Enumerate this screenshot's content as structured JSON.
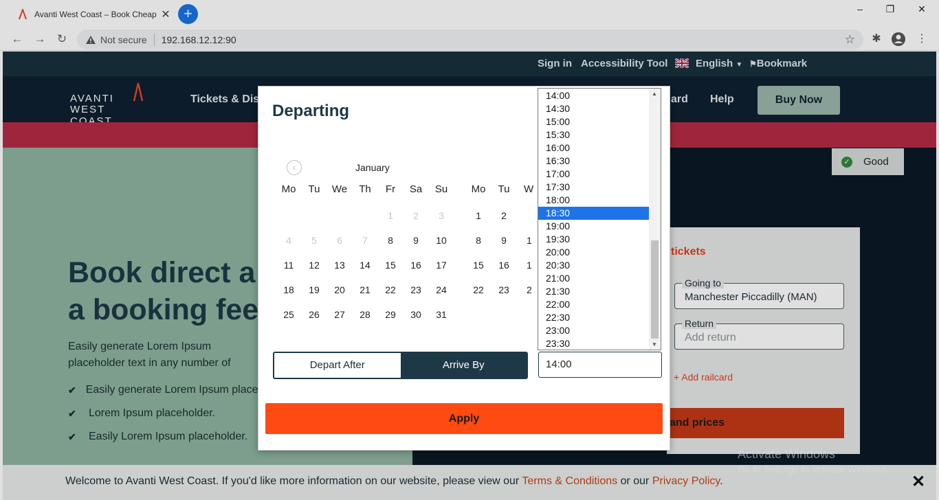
{
  "browser": {
    "tab_title": "Avanti West Coast – Book Cheap",
    "security_label": "Not secure",
    "url": "192.168.12.12:90",
    "new_tab_symbol": "+",
    "close_symbol": "✕"
  },
  "site": {
    "topbar": {
      "sign_in": "Sign in",
      "accessibility": "Accessibility Tool",
      "language": "English",
      "bookmark": "Bookmark"
    },
    "logo": {
      "line1": "AVANTI",
      "line2": "WEST COAST"
    },
    "nav": {
      "tickets": "Tickets & Disc",
      "board": "ard",
      "help": "Help",
      "buy_now": "Buy Now"
    },
    "good_badge": "Good",
    "hero": {
      "headline_1": "Book direct a",
      "headline_2": "a booking fee",
      "paragraph": "Easily generate Lorem Ipsum placeholder text in any number of characters, words sentences or paragraphs.",
      "bullets": [
        "Easily generate Lorem Ipsum placeholder.",
        "Lorem Ipsum placeholder.",
        "Easily Lorem Ipsum placeholder."
      ]
    },
    "booking": {
      "title": "tickets",
      "going_to_label": "Going to",
      "going_to_value": "Manchester Piccadilly (MAN)",
      "return_label": "Return",
      "return_placeholder": "Add return",
      "railcard": "+ Add railcard",
      "find_button": "and prices"
    },
    "cookie": {
      "text": "Welcome to Avanti West Coast. If you'd like more information on our website, please view our ",
      "terms": "Terms & Conditions",
      "or": " or our ",
      "privacy": "Privacy Policy",
      "period": "."
    },
    "watermark": {
      "line1": "Activate Windows",
      "line2": "Go to Settings to activate Windows."
    }
  },
  "modal": {
    "title": "Departing",
    "month_label": "January",
    "weekdays_left": [
      "Mo",
      "Tu",
      "We",
      "Th",
      "Fr",
      "Sa",
      "Su"
    ],
    "weekdays_right": [
      "Mo",
      "Tu",
      "W"
    ],
    "left_weeks": [
      [
        "",
        "",
        "",
        "",
        "1",
        "2",
        "3"
      ],
      [
        "4",
        "5",
        "6",
        "7",
        "8",
        "9",
        "10"
      ],
      [
        "11",
        "12",
        "13",
        "14",
        "15",
        "16",
        "17"
      ],
      [
        "18",
        "19",
        "20",
        "21",
        "22",
        "23",
        "24"
      ],
      [
        "25",
        "26",
        "27",
        "28",
        "29",
        "30",
        "31"
      ]
    ],
    "right_weeks": [
      [
        "1",
        "2",
        ""
      ],
      [
        "8",
        "9",
        "1"
      ],
      [
        "15",
        "16",
        "1"
      ],
      [
        "22",
        "23",
        "2"
      ]
    ],
    "depart_after": "Depart After",
    "arrive_by": "Arrive By",
    "time_value": "14:00",
    "apply": "Apply"
  },
  "time_options": [
    "14:00",
    "14:30",
    "15:00",
    "15:30",
    "16:00",
    "16:30",
    "17:00",
    "17:30",
    "18:00",
    "18:30",
    "19:00",
    "19:30",
    "20:00",
    "20:30",
    "21:00",
    "21:30",
    "22:00",
    "22:30",
    "23:00",
    "23:30"
  ],
  "selected_time": "18:30",
  "colors": {
    "accent_orange": "#ff4a12",
    "navy": "#1d3947",
    "selection_blue": "#1e73e8"
  }
}
